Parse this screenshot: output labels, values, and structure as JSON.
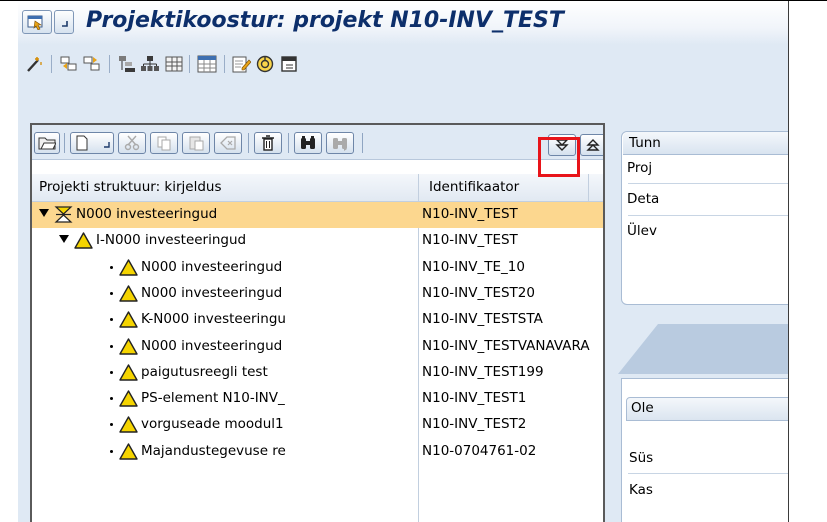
{
  "window": {
    "title": "Projektikoostur: projekt N10-INV_TEST"
  },
  "icons": {
    "title": [
      "menu-icon",
      "dropdown-arrow-icon"
    ],
    "standard_toolbar": [
      "magic-wand-icon",
      "switch-left-icon",
      "switch-right-icon",
      "hierarchy-icon",
      "org-structure-icon",
      "matrix-icon",
      "table-settings-icon",
      "document-edit-icon",
      "cycle-icon",
      "exit-screen-icon"
    ],
    "panel_toolbar": [
      "open-folder-icon",
      "new-document-icon",
      "dropdown-arrow-icon",
      "cut-icon",
      "copy-icon",
      "paste-icon",
      "undo-icon",
      "delete-icon",
      "find-icon",
      "find-next-icon",
      "expand-all-icon",
      "collapse-all-icon"
    ]
  },
  "tree": {
    "columns": [
      "Projekti struktuur: kirjeldus",
      "Identifikaator"
    ],
    "rows": [
      {
        "label": "N000 investeeringud",
        "id": "N10-INV_TEST",
        "level": 0,
        "node": "expanded",
        "icon": "project-definition-icon",
        "selected": true
      },
      {
        "label": "I-N000 investeeringud",
        "id": "N10-INV_TEST",
        "level": 1,
        "node": "expanded",
        "icon": "wbs-element-icon",
        "selected": false
      },
      {
        "label": "N000 investeeringud",
        "id": "N10-INV_TE_10",
        "level": 2,
        "node": "leaf",
        "icon": "wbs-element-icon",
        "selected": false
      },
      {
        "label": "N000 investeeringud",
        "id": "N10-INV_TEST20",
        "level": 2,
        "node": "leaf",
        "icon": "wbs-element-icon",
        "selected": false
      },
      {
        "label": "K-N000 investeeringu",
        "id": "N10-INV_TESTSTA",
        "level": 2,
        "node": "leaf",
        "icon": "wbs-element-icon",
        "selected": false
      },
      {
        "label": "N000 investeeringud",
        "id": "N10-INV_TESTVANAVARA",
        "level": 2,
        "node": "leaf",
        "icon": "wbs-element-icon",
        "selected": false
      },
      {
        "label": "paigutusreegli test",
        "id": "N10-INV_TEST199",
        "level": 2,
        "node": "leaf",
        "icon": "wbs-element-icon",
        "selected": false
      },
      {
        "label": "PS-element N10-INV_",
        "id": "N10-INV_TEST1",
        "level": 2,
        "node": "leaf",
        "icon": "wbs-element-icon",
        "selected": false
      },
      {
        "label": "vorguseade moodul1",
        "id": "N10-INV_TEST2",
        "level": 2,
        "node": "leaf",
        "icon": "wbs-element-icon",
        "selected": false
      },
      {
        "label": "Majandustegevuse re",
        "id": "N10-0704761-02",
        "level": 2,
        "node": "leaf",
        "icon": "wbs-element-icon",
        "selected": false
      }
    ]
  },
  "detail": {
    "tab_label": "Tunn",
    "rows": [
      "Proj",
      "Deta",
      "Ülev"
    ],
    "lower_tab_label": "Ole",
    "lower_rows": [
      "Süs",
      "Kas"
    ]
  },
  "colors": {
    "background": "#dfe9f4",
    "title_text": "#0d2f6b",
    "selected_row": "#fcd78f",
    "highlight_box": "#e8141a",
    "warning_triangle": "#f5d400"
  }
}
